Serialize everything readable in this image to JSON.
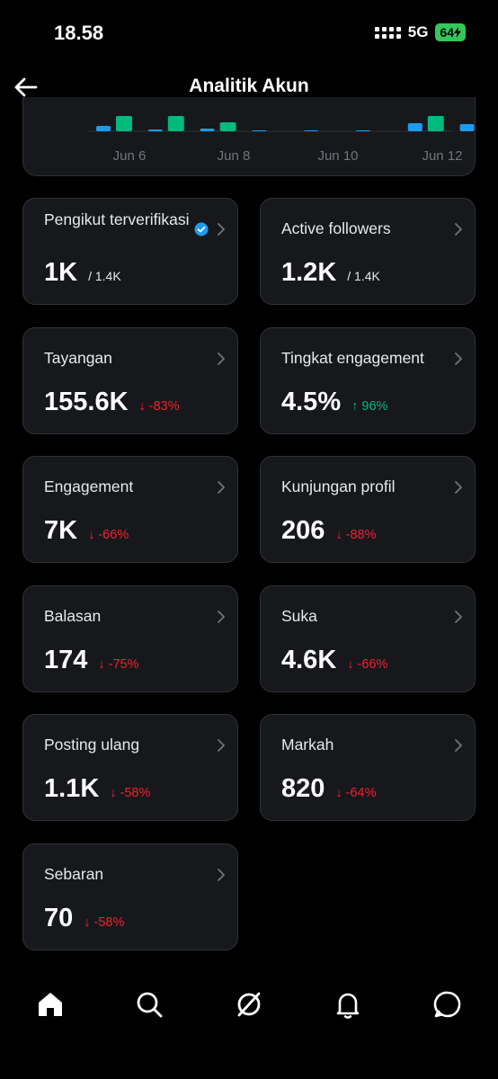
{
  "status": {
    "time": "18.58",
    "network": "5G",
    "battery": "64"
  },
  "header": {
    "title": "Analitik Akun"
  },
  "chart_data": {
    "type": "bar",
    "x_tick_labels": [
      "Jun 6",
      "Jun 8",
      "Jun 10",
      "Jun 12"
    ],
    "series": [
      {
        "color": "#1d9bf0"
      },
      {
        "color": "#00ba7c"
      }
    ]
  },
  "cards": [
    {
      "label": "Pengikut terverifikasi",
      "value": "1K",
      "sub": "/ 1.4K",
      "verified": true
    },
    {
      "label": "Active followers",
      "value": "1.2K",
      "sub": "/ 1.4K"
    },
    {
      "label": "Tayangan",
      "value": "155.6K",
      "delta": "↓ -83%",
      "dir": "down"
    },
    {
      "label": "Tingkat engagement",
      "value": "4.5%",
      "delta": "↑ 96%",
      "dir": "up"
    },
    {
      "label": "Engagement",
      "value": "7K",
      "delta": "↓ -66%",
      "dir": "down"
    },
    {
      "label": "Kunjungan profil",
      "value": "206",
      "delta": "↓ -88%",
      "dir": "down"
    },
    {
      "label": "Balasan",
      "value": "174",
      "delta": "↓ -75%",
      "dir": "down"
    },
    {
      "label": "Suka",
      "value": "4.6K",
      "delta": "↓ -66%",
      "dir": "down"
    },
    {
      "label": "Posting ulang",
      "value": "1.1K",
      "delta": "↓ -58%",
      "dir": "down"
    },
    {
      "label": "Markah",
      "value": "820",
      "delta": "↓ -64%",
      "dir": "down"
    },
    {
      "label": "Sebaran",
      "value": "70",
      "delta": "↓ -58%",
      "dir": "down"
    }
  ],
  "nav": [
    "home-icon",
    "search-icon",
    "grok-icon",
    "notifications-icon",
    "messages-icon"
  ]
}
